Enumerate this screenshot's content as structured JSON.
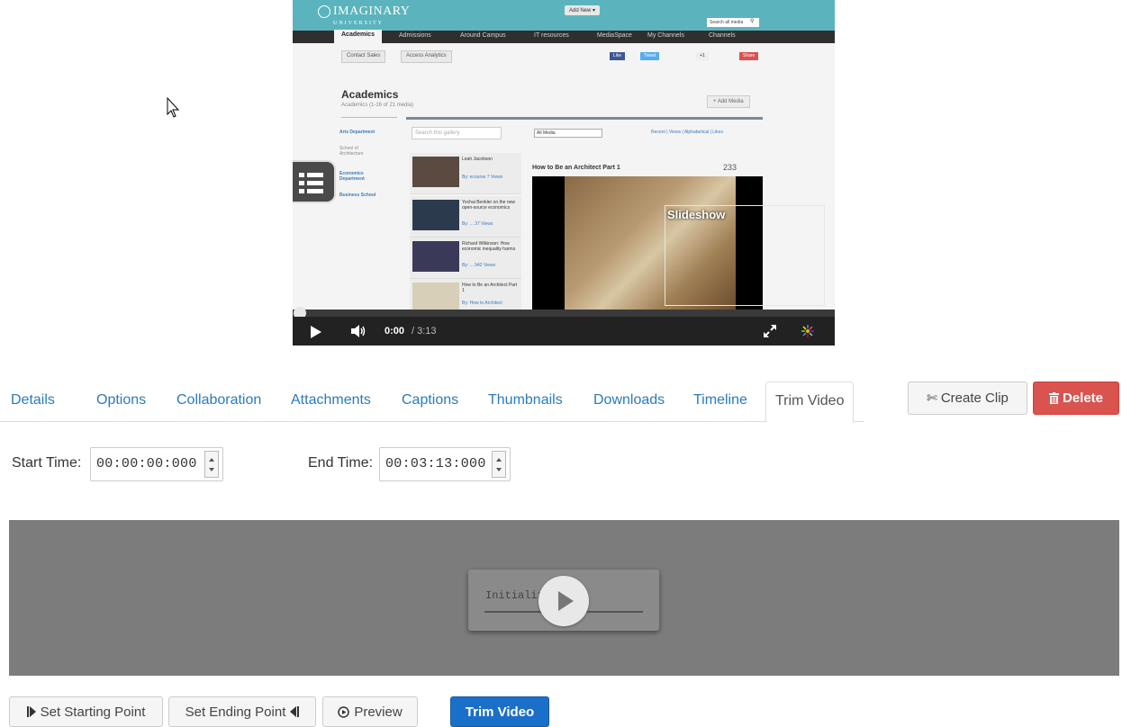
{
  "player": {
    "embedded_site": {
      "logo_text": "IMAGINARY",
      "logo_subtext": "UNIVERSITY",
      "add_new": "Add New ▾",
      "search_placeholder": "Search all media",
      "nav": [
        "Academics",
        "Admissions",
        "Around Campus",
        "IT resources",
        "MediaSpace",
        "My Channels",
        "Channels"
      ],
      "buttons": [
        "Contact Sales",
        "Access Analytics"
      ],
      "heading": "Academics",
      "subheading": "Academics (1-16 of 21 media)",
      "add_media": "+ Add Media",
      "side_links": [
        "Arts Department",
        "School of Architecture",
        "Economics Department",
        "Business School"
      ],
      "gallery_search_placeholder": "Search this gallery",
      "filter_value": "All Media",
      "sort_links": "Recent | Views | Alphabetical | Likes",
      "thumbnails": [
        {
          "title": "Leah Jacobson",
          "meta": "By: ecourse 7 Views"
        },
        {
          "title": "Yochai Benkler on the new open-source economics",
          "meta": "By: ... 37 Views"
        },
        {
          "title": "Richard Wilkinson: How economic inequality harms",
          "meta": "By: ... 942 Views"
        },
        {
          "title": "How to Be an Architect Part 1",
          "meta": "By: How to Architect"
        }
      ],
      "media_title": "How to Be an Architect Part 1",
      "media_views": "233"
    },
    "slideshow_label": "Slideshow",
    "current_time": "0:00",
    "total_time": "/ 3:13"
  },
  "tabs": [
    {
      "label": "Details"
    },
    {
      "label": "Options"
    },
    {
      "label": "Collaboration"
    },
    {
      "label": "Attachments"
    },
    {
      "label": "Captions"
    },
    {
      "label": "Thumbnails"
    },
    {
      "label": "Downloads"
    },
    {
      "label": "Timeline"
    },
    {
      "label": "Trim Video",
      "active": true
    }
  ],
  "actions": {
    "create_clip_icon": "scissors-icon",
    "create_clip": "Create Clip",
    "delete_icon": "trash-icon",
    "delete": "Delete"
  },
  "trim": {
    "start_label": "Start Time:",
    "start_value": "00:00:00:000",
    "end_label": "End Time:",
    "end_value": "00:03:13:000",
    "status_text": "Initializin"
  },
  "bottom_buttons": {
    "set_start": "Set Starting Point",
    "set_end": "Set Ending Point",
    "preview": "Preview",
    "trim_video": "Trim Video"
  },
  "colors": {
    "link_blue": "#2a7bbf",
    "danger_red": "#d9534f",
    "primary_blue": "#1a6fc9",
    "site_teal": "#5bb4bd"
  }
}
